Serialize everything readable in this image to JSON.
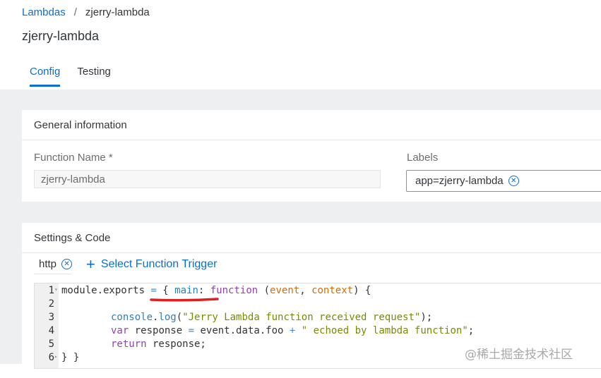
{
  "breadcrumb": {
    "parent": "Lambdas",
    "separator": "/",
    "current": "zjerry-lambda"
  },
  "page_title": "zjerry-lambda",
  "tabs": [
    {
      "label": "Config",
      "active": true
    },
    {
      "label": "Testing",
      "active": false
    }
  ],
  "general": {
    "title": "General information",
    "function_name_label": "Function Name *",
    "function_name_value": "zjerry-lambda",
    "labels_label": "Labels",
    "label_token": "app=zjerry-lambda"
  },
  "settings": {
    "title": "Settings & Code",
    "trigger_token": "http",
    "add_trigger_label": "Select Function Trigger"
  },
  "code": {
    "lines": [
      {
        "no": "1",
        "fold": true
      },
      {
        "no": "2"
      },
      {
        "no": "3"
      },
      {
        "no": "4"
      },
      {
        "no": "5"
      },
      {
        "no": "6",
        "fold": true
      }
    ],
    "l1_a": "module.exports ",
    "l1_eq": "=",
    "l1_b": " { ",
    "l1_main": "main",
    "l1_colon": ": ",
    "l1_function": "function",
    "l1_paren_open": " (",
    "l1_event": "event",
    "l1_comma": ", ",
    "l1_context": "context",
    "l1_end": ") {",
    "l3_console": "console",
    "l3_dot": ".",
    "l3_log": "log",
    "l3_open": "(",
    "l3_str": "\"Jerry Lambda function received request\"",
    "l3_close": ");",
    "l4_var": "var",
    "l4_rest": " response ",
    "l4_eq": "=",
    "l4_mid": " event.data.foo ",
    "l4_plus": "+",
    "l4_str": " \" echoed by lambda function\"",
    "l4_end": ";",
    "l5_return": "return",
    "l5_rest": " response;",
    "l6": "} }"
  },
  "watermark": "@稀土掘金技术社区",
  "colors": {
    "accent": "#0a6ed1",
    "annotation_red": "#e02020"
  }
}
